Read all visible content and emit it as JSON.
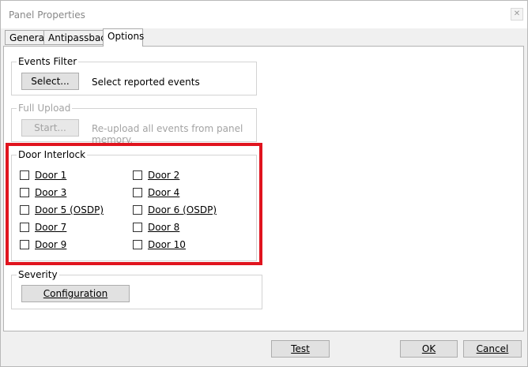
{
  "window": {
    "title": "Panel Properties",
    "close_glyph": "✕"
  },
  "tabs": [
    {
      "label": "General",
      "active": false
    },
    {
      "label": "Antipassback",
      "active": false
    },
    {
      "label": "Options",
      "active": true
    }
  ],
  "events_filter": {
    "legend": "Events Filter",
    "button": "Select...",
    "description": "Select reported events"
  },
  "full_upload": {
    "legend": "Full Upload",
    "button": "Start...",
    "description": "Re-upload all events from panel memory.",
    "enabled": false
  },
  "door_interlock": {
    "legend": "Door Interlock",
    "highlight_color": "#e0141e",
    "doors": [
      {
        "label": "Door 1",
        "checked": false
      },
      {
        "label": "Door 2",
        "checked": false
      },
      {
        "label": "Door 3",
        "checked": false
      },
      {
        "label": "Door 4",
        "checked": false
      },
      {
        "label": "Door 5 (OSDP)",
        "checked": false
      },
      {
        "label": "Door 6 (OSDP)",
        "checked": false
      },
      {
        "label": "Door 7",
        "checked": false
      },
      {
        "label": "Door 8",
        "checked": false
      },
      {
        "label": "Door 9",
        "checked": false
      },
      {
        "label": "Door 10",
        "checked": false
      }
    ]
  },
  "severity": {
    "legend": "Severity",
    "button": "Configuration"
  },
  "footer": {
    "test": "Test",
    "ok": "OK",
    "cancel": "Cancel"
  }
}
